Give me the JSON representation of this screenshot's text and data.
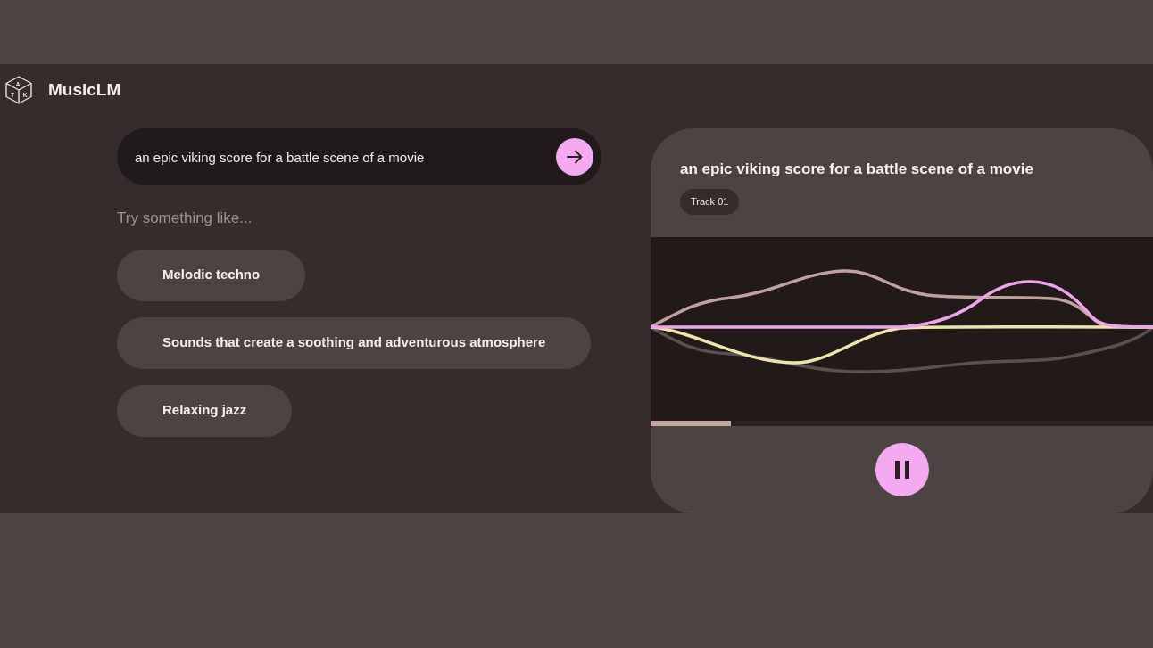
{
  "header": {
    "logo": {
      "face_letters": [
        "AI",
        "T",
        "K"
      ]
    },
    "app_name": "MusicLM"
  },
  "prompt": {
    "value": "an epic viking score for a battle scene of a movie"
  },
  "suggestions": {
    "heading": "Try something like...",
    "items": [
      "Melodic techno",
      "Sounds that create a soothing and adventurous atmosphere",
      "Relaxing jazz"
    ]
  },
  "player": {
    "title": "an epic viking score for a battle scene of a movie",
    "track_badge": "Track 01",
    "progress": {
      "level": 0.16
    },
    "playing": true
  }
}
